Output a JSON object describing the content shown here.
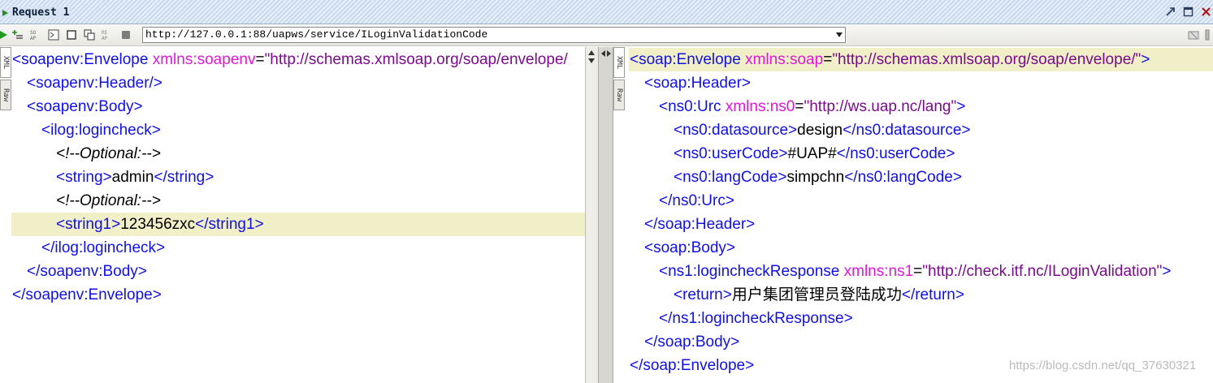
{
  "window": {
    "title": "Request 1"
  },
  "toolbar": {
    "url": "http://127.0.0.1:88/uapws/service/ILoginValidationCode"
  },
  "tabs": {
    "xml": "XML",
    "raw": "Raw"
  },
  "request": {
    "lines": [
      {
        "indent": 0,
        "parts": [
          [
            "tag",
            "<soapenv:Envelope "
          ],
          [
            "attr",
            "xmlns:soapenv"
          ],
          [
            "txt",
            "="
          ],
          [
            "val",
            "\"http://schemas.xmlsoap.org/soap/envelope/"
          ]
        ]
      },
      {
        "indent": 1,
        "parts": [
          [
            "tag",
            "<soapenv:Header/>"
          ]
        ]
      },
      {
        "indent": 1,
        "parts": [
          [
            "tag",
            "<soapenv:Body>"
          ]
        ]
      },
      {
        "indent": 2,
        "parts": [
          [
            "tag",
            "<ilog:logincheck>"
          ]
        ]
      },
      {
        "indent": 3,
        "parts": [
          [
            "cmt",
            "<!--Optional:-->"
          ]
        ]
      },
      {
        "indent": 3,
        "parts": [
          [
            "tag",
            "<string>"
          ],
          [
            "txt",
            "admin"
          ],
          [
            "tag",
            "</string>"
          ]
        ]
      },
      {
        "indent": 3,
        "parts": [
          [
            "cmt",
            "<!--Optional:-->"
          ]
        ]
      },
      {
        "indent": 3,
        "highlight": true,
        "parts": [
          [
            "tag",
            "<string1>"
          ],
          [
            "txt",
            "123456zxc"
          ],
          [
            "tag",
            "</string1>"
          ]
        ]
      },
      {
        "indent": 2,
        "parts": [
          [
            "tag",
            "</ilog:logincheck>"
          ]
        ]
      },
      {
        "indent": 1,
        "parts": [
          [
            "tag",
            "</soapenv:Body>"
          ]
        ]
      },
      {
        "indent": 0,
        "parts": [
          [
            "tag",
            "</soapenv:Envelope>"
          ]
        ]
      }
    ]
  },
  "response": {
    "lines": [
      {
        "indent": 0,
        "highlight": true,
        "parts": [
          [
            "tag",
            "<soap:Envelope "
          ],
          [
            "attr",
            "xmlns:soap"
          ],
          [
            "txt",
            "="
          ],
          [
            "val",
            "\"http://schemas.xmlsoap.org/soap/envelope/\""
          ],
          [
            "tag",
            ">"
          ]
        ]
      },
      {
        "indent": 1,
        "parts": [
          [
            "tag",
            "<soap:Header>"
          ]
        ]
      },
      {
        "indent": 2,
        "parts": [
          [
            "tag",
            "<ns0:Urc "
          ],
          [
            "attr",
            "xmlns:ns0"
          ],
          [
            "txt",
            "="
          ],
          [
            "val",
            "\"http://ws.uap.nc/lang\""
          ],
          [
            "tag",
            ">"
          ]
        ]
      },
      {
        "indent": 3,
        "parts": [
          [
            "tag",
            "<ns0:datasource>"
          ],
          [
            "txt",
            "design"
          ],
          [
            "tag",
            "</ns0:datasource>"
          ]
        ]
      },
      {
        "indent": 3,
        "parts": [
          [
            "tag",
            "<ns0:userCode>"
          ],
          [
            "txt",
            "#UAP#"
          ],
          [
            "tag",
            "</ns0:userCode>"
          ]
        ]
      },
      {
        "indent": 3,
        "parts": [
          [
            "tag",
            "<ns0:langCode>"
          ],
          [
            "txt",
            "simpchn"
          ],
          [
            "tag",
            "</ns0:langCode>"
          ]
        ]
      },
      {
        "indent": 2,
        "parts": [
          [
            "tag",
            "</ns0:Urc>"
          ]
        ]
      },
      {
        "indent": 1,
        "parts": [
          [
            "tag",
            "</soap:Header>"
          ]
        ]
      },
      {
        "indent": 1,
        "parts": [
          [
            "tag",
            "<soap:Body>"
          ]
        ]
      },
      {
        "indent": 2,
        "parts": [
          [
            "tag",
            "<ns1:logincheckResponse "
          ],
          [
            "attr",
            "xmlns:ns1"
          ],
          [
            "txt",
            "="
          ],
          [
            "val",
            "\"http://check.itf.nc/ILoginValidation\""
          ],
          [
            "tag",
            ">"
          ]
        ]
      },
      {
        "indent": 3,
        "parts": [
          [
            "tag",
            "<return>"
          ],
          [
            "txt",
            "用户集团管理员登陆成功"
          ],
          [
            "tag",
            "</return>"
          ]
        ]
      },
      {
        "indent": 2,
        "parts": [
          [
            "tag",
            "</ns1:logincheckResponse>"
          ]
        ]
      },
      {
        "indent": 1,
        "parts": [
          [
            "tag",
            "</soap:Body>"
          ]
        ]
      },
      {
        "indent": 0,
        "parts": [
          [
            "tag",
            "</soap:Envelope>"
          ]
        ]
      }
    ]
  },
  "watermark": "https://blog.csdn.net/qq_37630321",
  "colors": {
    "tag": "#1010e8",
    "attribute": "#e018d4",
    "value": "#7a0b8c",
    "highlight": "#f0efc8"
  }
}
